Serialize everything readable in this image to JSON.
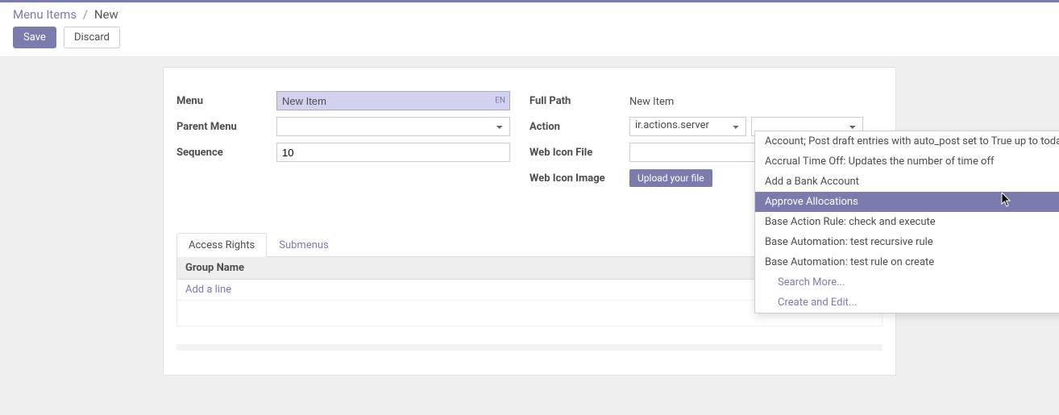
{
  "breadcrumb": {
    "parent": "Menu Items",
    "sep": "/",
    "current": "New"
  },
  "toolbar": {
    "save": "Save",
    "discard": "Discard"
  },
  "form": {
    "left": {
      "menu_label": "Menu",
      "menu_value": "New Item",
      "menu_lang": "EN",
      "parent_menu_label": "Parent Menu",
      "parent_menu_value": "",
      "sequence_label": "Sequence",
      "sequence_value": "10"
    },
    "right": {
      "full_path_label": "Full Path",
      "full_path_value": "New Item",
      "action_label": "Action",
      "action_type": "ir.actions.server",
      "action_value": "",
      "web_icon_file_label": "Web Icon File",
      "web_icon_file_value": "",
      "web_icon_image_label": "Web Icon Image",
      "upload_button": "Upload your file"
    }
  },
  "tabs": {
    "access_rights": "Access Rights",
    "submenus": "Submenus"
  },
  "list": {
    "header": "Group Name",
    "add_line": "Add a line"
  },
  "dropdown": {
    "items": [
      {
        "label": "Account; Post draft entries with auto_post set to True up to today",
        "highlighted": false
      },
      {
        "label": "Accrual Time Off: Updates the number of time off",
        "highlighted": false
      },
      {
        "label": "Add a Bank Account",
        "highlighted": false
      },
      {
        "label": "Approve Allocations",
        "highlighted": true
      },
      {
        "label": "Base Action Rule: check and execute",
        "highlighted": false
      },
      {
        "label": "Base Automation: test recursive rule",
        "highlighted": false
      },
      {
        "label": "Base Automation: test rule on create",
        "highlighted": false
      }
    ],
    "search_more": "Search More...",
    "create_edit": "Create and Edit..."
  }
}
